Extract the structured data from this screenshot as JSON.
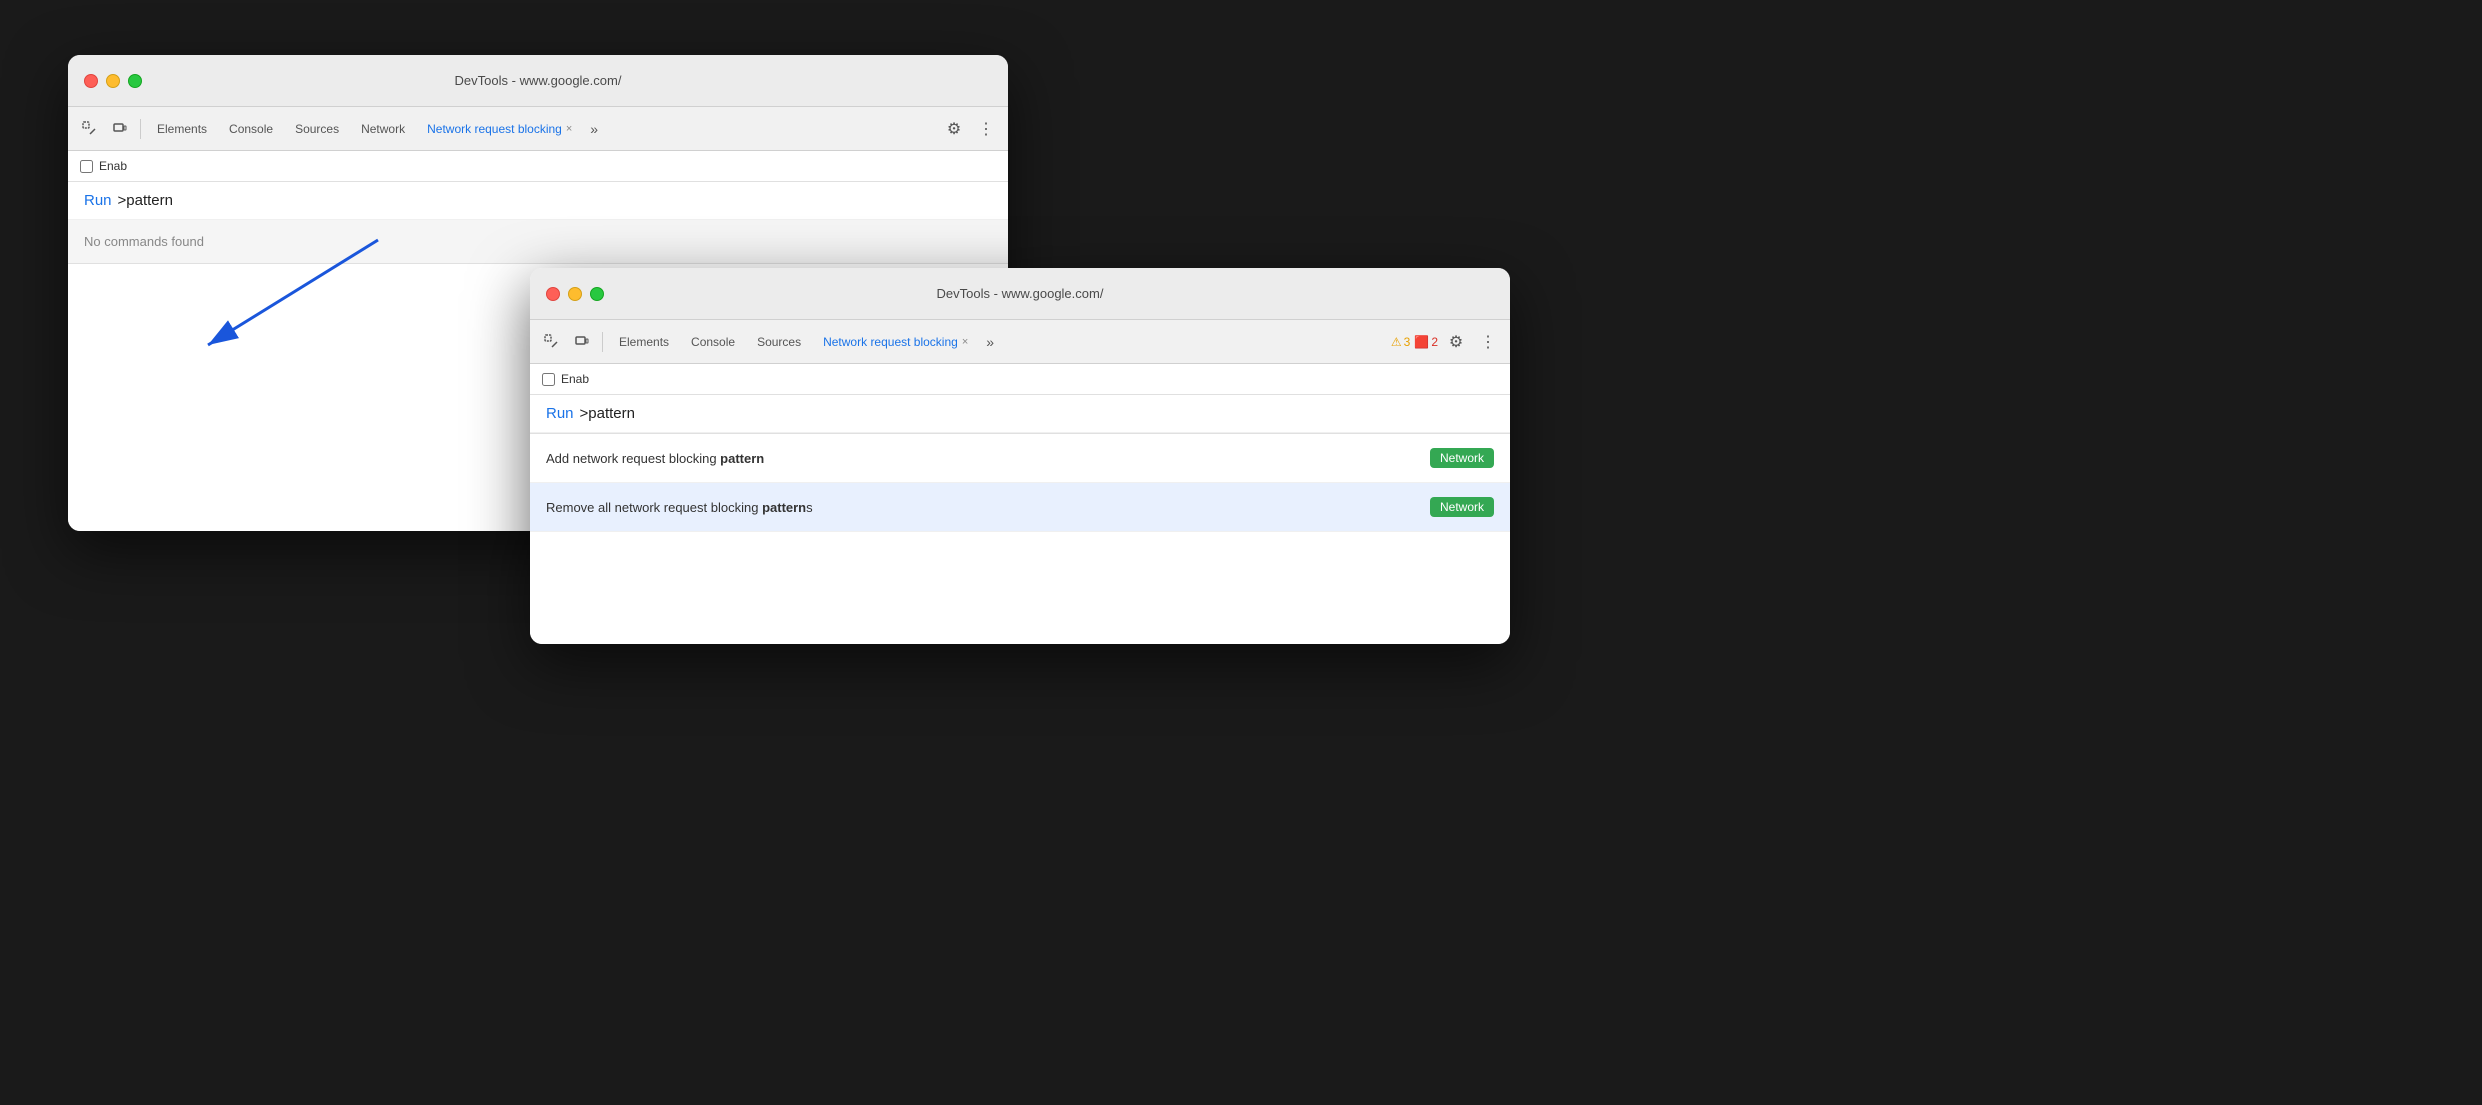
{
  "window1": {
    "title": "DevTools - www.google.com/",
    "toolbar": {
      "tabs": [
        "Elements",
        "Console",
        "Sources",
        "Network",
        "Network request blocking"
      ],
      "active_tab": "Network request blocking",
      "gear_label": "⚙",
      "more_label": "⋮",
      "more_tabs_label": "»"
    },
    "checkbox_label": "Enab",
    "command_palette": {
      "run_label": "Run",
      "input_text": ">pattern",
      "no_results": "No commands found"
    }
  },
  "window2": {
    "title": "DevTools - www.google.com/",
    "toolbar": {
      "tabs": [
        "Elements",
        "Console",
        "Sources",
        "Network request blocking"
      ],
      "active_tab": "Network request blocking",
      "gear_label": "⚙",
      "more_label": "⋮",
      "more_tabs_label": "»",
      "warning_count": "3",
      "error_count": "2"
    },
    "checkbox_label": "Enab",
    "command_palette": {
      "run_label": "Run",
      "input_text": ">pattern"
    },
    "results": [
      {
        "id": "result1",
        "text_plain": "Add network request blocking ",
        "text_bold": "pattern",
        "badge": "Network",
        "selected": false
      },
      {
        "id": "result2",
        "text_plain": "Remove all network request blocking ",
        "text_bold": "patterns",
        "text_suffix": "s",
        "badge": "Network",
        "selected": true
      }
    ]
  },
  "badge_network": "Network",
  "icons": {
    "selector": "⬚",
    "device": "▭",
    "gear": "⚙",
    "more": "⋮",
    "more_tabs": "»",
    "warning": "⚠",
    "error": "🟧",
    "close": "×",
    "checkbox": "☐"
  }
}
